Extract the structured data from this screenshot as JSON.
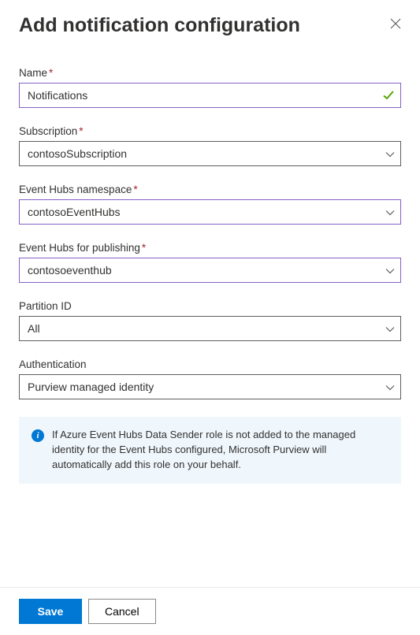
{
  "title": "Add notification configuration",
  "fields": {
    "name": {
      "label": "Name",
      "required": true,
      "value": "Notifications",
      "valid": true
    },
    "subscription": {
      "label": "Subscription",
      "required": true,
      "value": "contosoSubscription"
    },
    "namespace": {
      "label": "Event Hubs namespace",
      "required": true,
      "value": "contosoEventHubs"
    },
    "publishing": {
      "label": "Event Hubs for publishing",
      "required": true,
      "value": "contosoeventhub"
    },
    "partition": {
      "label": "Partition ID",
      "required": false,
      "value": "All"
    },
    "auth": {
      "label": "Authentication",
      "required": false,
      "value": "Purview managed identity"
    }
  },
  "info": "If Azure Event Hubs Data Sender role is not added to the managed identity for the Event Hubs configured, Microsoft Purview will automatically add this role on your behalf.",
  "buttons": {
    "save": "Save",
    "cancel": "Cancel"
  },
  "colors": {
    "primary": "#0078d4",
    "accentBorder": "#8661c5",
    "required": "#a4262c",
    "infoBg": "#eff6fc"
  }
}
